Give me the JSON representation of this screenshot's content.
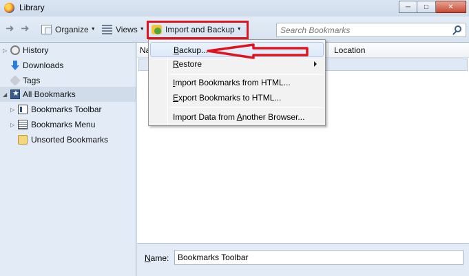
{
  "window": {
    "title": "Library",
    "controls": [
      "minimize",
      "maximize",
      "close"
    ]
  },
  "toolbar": {
    "organize_label": "Organize",
    "views_label": "Views",
    "import_backup_label": "Import and Backup"
  },
  "search": {
    "placeholder": "Search Bookmarks"
  },
  "sidebar": {
    "items": [
      {
        "label": "History",
        "icon": "history-icon"
      },
      {
        "label": "Downloads",
        "icon": "downloads-icon"
      },
      {
        "label": "Tags",
        "icon": "tags-icon"
      },
      {
        "label": "All Bookmarks",
        "icon": "all-bookmarks-icon",
        "selected": true
      },
      {
        "label": "Bookmarks Toolbar",
        "icon": "bookmarks-toolbar-icon"
      },
      {
        "label": "Bookmarks Menu",
        "icon": "bookmarks-menu-icon"
      },
      {
        "label": "Unsorted Bookmarks",
        "icon": "unsorted-bookmarks-icon"
      }
    ]
  },
  "main": {
    "columns": {
      "name": "Na",
      "location": "Location"
    }
  },
  "menu": {
    "items": [
      {
        "prefix": "",
        "accel": "B",
        "rest": "ackup...",
        "hover": true
      },
      {
        "prefix": "",
        "accel": "R",
        "rest": "estore",
        "submenu": true
      },
      {
        "prefix": "",
        "accel": "I",
        "rest": "mport Bookmarks from HTML..."
      },
      {
        "prefix": "",
        "accel": "E",
        "rest": "xport Bookmarks to HTML..."
      },
      {
        "prefix": "Import Data from ",
        "accel": "A",
        "rest": "nother Browser..."
      }
    ]
  },
  "details": {
    "name_label_accel": "N",
    "name_label_rest": "ame:",
    "name_value": "Bookmarks Toolbar"
  },
  "colors": {
    "annotation": "#e0141e",
    "window_bg": "#d8e4f1",
    "sidebar_selected": "#d0dcea"
  }
}
